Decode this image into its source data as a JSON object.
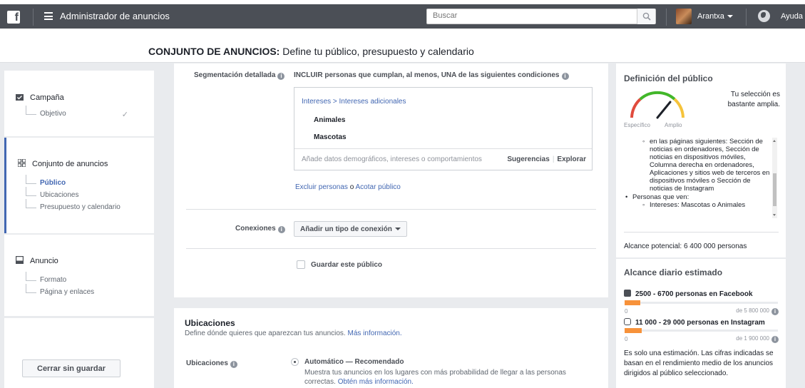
{
  "topbar": {
    "logo": "f",
    "app_title": "Administrador de anuncios",
    "search_placeholder": "Buscar",
    "user_name": "Arantxa",
    "help": "Ayuda"
  },
  "header": {
    "title_bold": "CONJUNTO DE ANUNCIOS:",
    "title_rest": " Define tu público, presupuesto y calendario"
  },
  "sidebar": {
    "campaign": {
      "label": "Campaña",
      "items": [
        "Objetivo"
      ]
    },
    "adset": {
      "label": "Conjunto de anuncios",
      "items": [
        "Público",
        "Ubicaciones",
        "Presupuesto y calendario"
      ]
    },
    "ad": {
      "label": "Anuncio",
      "items": [
        "Formato",
        "Página y enlaces"
      ]
    },
    "close_button": "Cerrar sin guardar"
  },
  "targeting": {
    "label": "Segmentación detallada",
    "heading": "INCLUIR personas que cumplan, al menos, UNA de las siguientes condiciones",
    "breadcrumb": "Intereses > Intereses adicionales",
    "interests": [
      "Animales",
      "Mascotas"
    ],
    "input_placeholder": "Añade datos demográficos, intereses o comportamientos",
    "suggestions": "Sugerencias",
    "browse": "Explorar",
    "exclude_link": "Excluir personas",
    "or": " o ",
    "narrow_link": "Acotar público"
  },
  "connections": {
    "label": "Conexiones",
    "button": "Añadir un tipo de conexión"
  },
  "save_audience": "Guardar este público",
  "placements": {
    "title": "Ubicaciones",
    "subtitle": "Define dónde quieres que aparezcan tus anuncios. ",
    "subtitle_link": "Más información.",
    "label": "Ubicaciones",
    "option_title": "Automático — Recomendado",
    "option_desc": "Muestra tus anuncios en los lugares con más probabilidad de llegar a las personas correctas. ",
    "option_link": "Obtén más información."
  },
  "audience_definition": {
    "title": "Definición del público",
    "gauge_specific": "Específico",
    "gauge_broad": "Amplio",
    "gauge_text": "Tu selección es bastante amplia.",
    "list_sub": "en las páginas siguientes: Sección de noticias en ordenadores, Sección de noticias en dispositivos móviles, Columna derecha en ordenadores, Aplicaciones y sitios web de terceros en dispositivos móviles o Sección de noticias de Instagram",
    "list_bullet": "Personas que ven:",
    "list_sub2": "Intereses: Mascotas o Animales",
    "potential_reach": "Alcance potencial: 6 400 000 personas"
  },
  "daily_reach": {
    "title": "Alcance diario estimado",
    "facebook": {
      "range": "2500 - 6700 personas en Facebook",
      "min": "0",
      "max": "de 5 800 000",
      "fill_fraction": 0.1
    },
    "instagram": {
      "range": "11 000 - 29 000 personas en Instagram",
      "min": "0",
      "max": "de 1 900 000",
      "fill_fraction": 0.11
    },
    "note": "Es solo una estimación. Las cifras indicadas se basan en el rendimiento medio de los anuncios dirigidos al público seleccionado."
  },
  "colors": {
    "topbar": "#4b4f56",
    "accent": "#4267b2",
    "reach_bar": "#f7923a",
    "gauge_red": "#e04b3d",
    "gauge_green": "#42b72a",
    "gauge_yellow": "#f5c33b"
  }
}
